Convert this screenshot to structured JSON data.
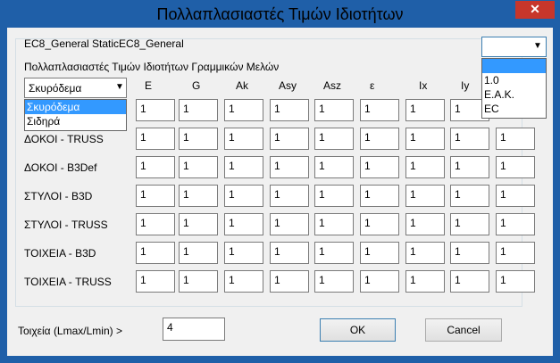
{
  "window": {
    "title": "Πολλαπλασιαστές Τιμών Ιδιοτήτων",
    "close_glyph": "✕"
  },
  "header_label": "EC8_General StaticEC8_General",
  "code_combo": {
    "value": "",
    "options": [
      "",
      "1.0",
      "E.A.K.",
      "EC"
    ],
    "selected_index": 0
  },
  "group": {
    "title": "Πολλαπλασιαστές Τιμών Ιδιοτήτων Γραμμικών Μελών"
  },
  "material_combo": {
    "value": "Σκυρόδεμα",
    "options": [
      "Σκυρόδεμα",
      "Σιδηρά"
    ],
    "selected_index": 0
  },
  "columns": [
    "E",
    "G",
    "Ak",
    "Asy",
    "Asz",
    "ε",
    "Ix",
    "Iy",
    ""
  ],
  "rows": [
    {
      "label": "",
      "values": [
        "1",
        "1",
        "1",
        "1",
        "1",
        "1",
        "1",
        "1"
      ]
    },
    {
      "label": "ΔΟΚΟΙ - TRUSS",
      "values": [
        "1",
        "1",
        "1",
        "1",
        "1",
        "1",
        "1",
        "1",
        "1"
      ]
    },
    {
      "label": "ΔΟΚΟΙ - B3Def",
      "values": [
        "1",
        "1",
        "1",
        "1",
        "1",
        "1",
        "1",
        "1",
        "1"
      ]
    },
    {
      "label": "ΣΤΥΛΟΙ - B3D",
      "values": [
        "1",
        "1",
        "1",
        "1",
        "1",
        "1",
        "1",
        "1",
        "1"
      ]
    },
    {
      "label": "ΣΤΥΛΟΙ - TRUSS",
      "values": [
        "1",
        "1",
        "1",
        "1",
        "1",
        "1",
        "1",
        "1",
        "1"
      ]
    },
    {
      "label": "ΤΟΙΧΕΙΑ - B3D",
      "values": [
        "1",
        "1",
        "1",
        "1",
        "1",
        "1",
        "1",
        "1",
        "1"
      ]
    },
    {
      "label": "ΤΟΙΧΕΙΑ - TRUSS",
      "values": [
        "1",
        "1",
        "1",
        "1",
        "1",
        "1",
        "1",
        "1",
        "1"
      ]
    }
  ],
  "ratio": {
    "label": "Τοιχεία (Lmax/Lmin) >",
    "value": "4"
  },
  "buttons": {
    "ok": "OK",
    "cancel": "Cancel"
  }
}
